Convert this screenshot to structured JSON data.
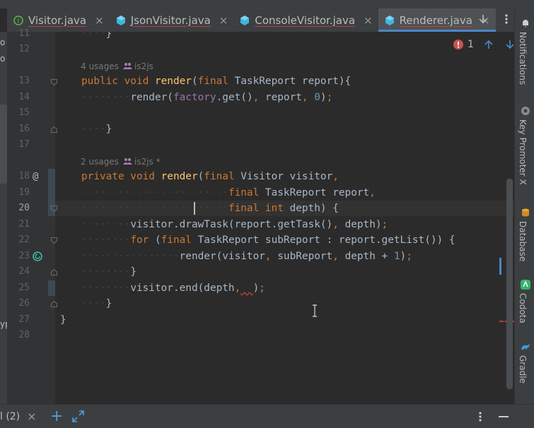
{
  "tabs": [
    {
      "label": "Visitor.java",
      "icon": "interface-icon",
      "active": false
    },
    {
      "label": "JsonVisitor.java",
      "icon": "class-icon",
      "active": false
    },
    {
      "label": "ConsoleVisitor.java",
      "icon": "class-icon",
      "active": false
    },
    {
      "label": "Renderer.java",
      "icon": "class-icon",
      "active": true
    }
  ],
  "tab_close_glyph": "×",
  "left_panel": {
    "fragment_1": "o",
    "fragment_2": "o",
    "fragment_3": "yp"
  },
  "editor": {
    "error_count": "1",
    "hints": {
      "render_public": {
        "usages": "4 usages",
        "author": "is2js"
      },
      "render_private": {
        "usages": "2 usages",
        "author": "is2js *"
      }
    },
    "line_numbers": [
      "11",
      "12",
      "13",
      "14",
      "15",
      "16",
      "17",
      "18",
      "19",
      "20",
      "21",
      "22",
      "23",
      "24",
      "25",
      "26",
      "27",
      "28"
    ],
    "gutter_markers": {
      "override": "@",
      "recursive_call": "recursive-call-icon"
    }
  },
  "right_tool_windows": [
    "Notifications",
    "Key Promoter X",
    "Database",
    "Codota",
    "Gradle"
  ],
  "bottom_bar": {
    "tab_label": "l (2)",
    "close_glyph": "×",
    "add_glyph": "+"
  },
  "colors": {
    "keyword": "#cc7832",
    "function": "#ffc66d",
    "number": "#6897bb",
    "text": "#a9b7c6",
    "accent": "#4a88c7"
  }
}
